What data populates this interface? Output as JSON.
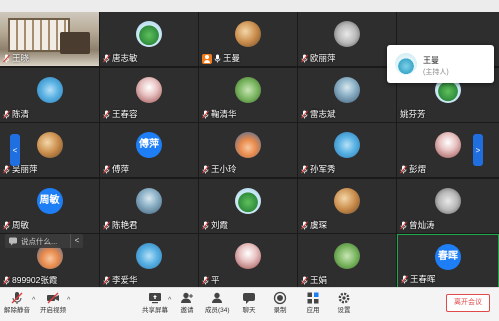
{
  "colors": {
    "tile_bg": "#2e2e2e",
    "accent": "#1e7ef5",
    "speaker_border": "#1fa84a",
    "host_badge": "#f07b1c",
    "leave": "#e04a4a"
  },
  "tiles": [
    {
      "name": "王晓",
      "avatar": "video",
      "icon": "mic-muted-icon"
    },
    {
      "name": "唐志敏",
      "avatar": "image",
      "icon": "mic-muted-icon"
    },
    {
      "name": "王曼",
      "avatar": "image",
      "icon": "mic-icon",
      "host": true
    },
    {
      "name": "欧丽萍",
      "avatar": "image",
      "icon": "mic-muted-icon"
    },
    {
      "name": "",
      "avatar": "none",
      "icon": ""
    },
    {
      "name": "陈清",
      "avatar": "image",
      "icon": "mic-muted-icon"
    },
    {
      "name": "王春容",
      "avatar": "image",
      "icon": "mic-muted-icon"
    },
    {
      "name": "鞠清华",
      "avatar": "image",
      "icon": "mic-muted-icon"
    },
    {
      "name": "雷志斌",
      "avatar": "image",
      "icon": "mic-muted-icon"
    },
    {
      "name": "姚芬芳",
      "avatar": "image",
      "icon": ""
    },
    {
      "name": "吴丽萍",
      "avatar": "image",
      "icon": "mic-muted-icon"
    },
    {
      "name": "傅萍",
      "avatar": "text",
      "avatar_text": "傅萍",
      "icon": "mic-muted-icon"
    },
    {
      "name": "王小玲",
      "avatar": "image",
      "icon": "mic-muted-icon"
    },
    {
      "name": "孙军秀",
      "avatar": "image",
      "icon": "mic-muted-icon"
    },
    {
      "name": "彭熠",
      "avatar": "image",
      "icon": "mic-muted-icon"
    },
    {
      "name": "周敏",
      "avatar": "text",
      "avatar_text": "周敏",
      "icon": "mic-muted-icon"
    },
    {
      "name": "陈艳君",
      "avatar": "image",
      "icon": "mic-muted-icon"
    },
    {
      "name": "刘霞",
      "avatar": "image",
      "icon": "mic-muted-icon"
    },
    {
      "name": "虞琛",
      "avatar": "image",
      "icon": "mic-muted-icon"
    },
    {
      "name": "曾灿涛",
      "avatar": "image",
      "icon": "mic-muted-icon"
    },
    {
      "name": "899902张霞",
      "avatar": "image",
      "icon": "mic-muted-icon"
    },
    {
      "name": "李爱华",
      "avatar": "image",
      "icon": "mic-muted-icon"
    },
    {
      "name": "平",
      "avatar": "image",
      "icon": "mic-muted-icon"
    },
    {
      "name": "王娟",
      "avatar": "image",
      "icon": "mic-muted-icon"
    },
    {
      "name": "王春晖",
      "avatar": "text",
      "avatar_text": "春晖",
      "icon": "mic-muted-icon",
      "speaking": true
    }
  ],
  "popup": {
    "name": "王曼",
    "role": "(主持人)"
  },
  "chat": {
    "placeholder": "说点什么...",
    "chevron": "<"
  },
  "nav": {
    "left": "<",
    "right": ">"
  },
  "toolbar": {
    "unmute": "解除静音",
    "video": "开启视频",
    "share": "共享屏幕",
    "invite": "邀请",
    "members": "成员(34)",
    "chat": "聊天",
    "record": "录制",
    "apps": "应用",
    "settings": "设置",
    "leave": "离开会议",
    "chevron": "^"
  }
}
